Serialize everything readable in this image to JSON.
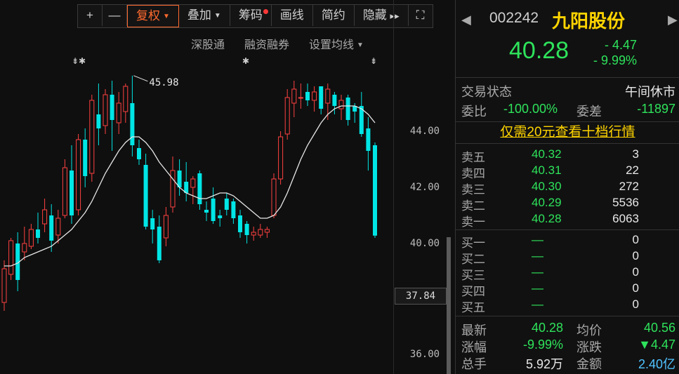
{
  "toolbar": {
    "plus": "+",
    "minus": "—",
    "fuquan": "复权",
    "diejia": "叠加",
    "chouma": "筹码",
    "huaxian": "画线",
    "jianyue": "简约",
    "yincang": "隐藏",
    "more": "▸▸",
    "expand": "⛶"
  },
  "subbar": {
    "sgt": "深股通",
    "rzrq": "融资融券",
    "ma_setting": "设置均线"
  },
  "chart": {
    "high_label": "45.98",
    "y_ticks": [
      "44.00",
      "42.00",
      "40.00",
      "36.00"
    ],
    "last_price_tag": "37.84",
    "marks": [
      "⇟✱",
      "✱",
      "⇟"
    ]
  },
  "chart_data": {
    "type": "candlestick",
    "y_axis_ticks": [
      44.0,
      42.0,
      40.0,
      36.0
    ],
    "high_marker": 45.98,
    "last_close": 40.28,
    "price_tag": 37.84,
    "candles": [
      {
        "o": 37.9,
        "h": 39.4,
        "l": 37.6,
        "c": 39.1
      },
      {
        "o": 38.9,
        "h": 40.2,
        "l": 38.7,
        "c": 40.1
      },
      {
        "o": 40.0,
        "h": 40.4,
        "l": 38.3,
        "c": 38.7
      },
      {
        "o": 39.7,
        "h": 40.6,
        "l": 39.4,
        "c": 40.0
      },
      {
        "o": 39.9,
        "h": 40.7,
        "l": 39.8,
        "c": 40.5
      },
      {
        "o": 40.5,
        "h": 41.1,
        "l": 40.0,
        "c": 40.2
      },
      {
        "o": 40.7,
        "h": 41.6,
        "l": 40.4,
        "c": 41.2
      },
      {
        "o": 41.0,
        "h": 41.4,
        "l": 39.7,
        "c": 40.1
      },
      {
        "o": 40.3,
        "h": 41.2,
        "l": 40.0,
        "c": 40.9
      },
      {
        "o": 41.0,
        "h": 43.0,
        "l": 40.9,
        "c": 42.7
      },
      {
        "o": 42.6,
        "h": 43.5,
        "l": 40.7,
        "c": 41.0
      },
      {
        "o": 41.2,
        "h": 43.9,
        "l": 41.0,
        "c": 43.7
      },
      {
        "o": 43.7,
        "h": 44.1,
        "l": 42.0,
        "c": 42.4
      },
      {
        "o": 42.5,
        "h": 45.3,
        "l": 42.2,
        "c": 45.1
      },
      {
        "o": 44.6,
        "h": 45.7,
        "l": 43.5,
        "c": 44.1
      },
      {
        "o": 44.2,
        "h": 45.5,
        "l": 43.9,
        "c": 45.3
      },
      {
        "o": 45.3,
        "h": 45.8,
        "l": 43.3,
        "c": 44.4
      },
      {
        "o": 44.3,
        "h": 45.4,
        "l": 43.9,
        "c": 45.0
      },
      {
        "o": 44.7,
        "h": 45.7,
        "l": 44.3,
        "c": 45.6
      },
      {
        "o": 45.0,
        "h": 45.98,
        "l": 43.1,
        "c": 43.5
      },
      {
        "o": 43.4,
        "h": 43.7,
        "l": 42.8,
        "c": 43.0
      },
      {
        "o": 42.8,
        "h": 43.2,
        "l": 40.5,
        "c": 40.6
      },
      {
        "o": 40.9,
        "h": 41.2,
        "l": 40.0,
        "c": 40.5
      },
      {
        "o": 40.6,
        "h": 41.0,
        "l": 39.3,
        "c": 39.4
      },
      {
        "o": 40.2,
        "h": 41.3,
        "l": 39.9,
        "c": 41.0
      },
      {
        "o": 41.3,
        "h": 43.1,
        "l": 41.1,
        "c": 42.6
      },
      {
        "o": 42.6,
        "h": 43.0,
        "l": 41.7,
        "c": 42.0
      },
      {
        "o": 42.2,
        "h": 42.9,
        "l": 41.5,
        "c": 41.8
      },
      {
        "o": 42.0,
        "h": 42.4,
        "l": 41.4,
        "c": 42.3
      },
      {
        "o": 42.5,
        "h": 42.6,
        "l": 41.2,
        "c": 41.4
      },
      {
        "o": 41.2,
        "h": 41.5,
        "l": 40.8,
        "c": 41.1
      },
      {
        "o": 41.6,
        "h": 42.0,
        "l": 40.7,
        "c": 40.8
      },
      {
        "o": 41.0,
        "h": 41.2,
        "l": 40.6,
        "c": 40.9
      },
      {
        "o": 41.6,
        "h": 41.8,
        "l": 41.0,
        "c": 41.2
      },
      {
        "o": 41.5,
        "h": 41.6,
        "l": 40.7,
        "c": 40.9
      },
      {
        "o": 41.0,
        "h": 41.2,
        "l": 40.2,
        "c": 40.4
      },
      {
        "o": 40.7,
        "h": 40.8,
        "l": 40.0,
        "c": 40.3
      },
      {
        "o": 40.3,
        "h": 40.6,
        "l": 40.1,
        "c": 40.4
      },
      {
        "o": 40.3,
        "h": 40.7,
        "l": 40.2,
        "c": 40.5
      },
      {
        "o": 40.4,
        "h": 40.6,
        "l": 40.2,
        "c": 40.5
      },
      {
        "o": 41.0,
        "h": 42.5,
        "l": 40.9,
        "c": 42.3
      },
      {
        "o": 42.3,
        "h": 44.0,
        "l": 42.1,
        "c": 43.8
      },
      {
        "o": 43.9,
        "h": 45.5,
        "l": 43.7,
        "c": 45.2
      },
      {
        "o": 45.0,
        "h": 45.8,
        "l": 44.5,
        "c": 45.5
      },
      {
        "o": 45.2,
        "h": 45.7,
        "l": 44.8,
        "c": 45.2
      },
      {
        "o": 45.4,
        "h": 45.7,
        "l": 44.9,
        "c": 45.1
      },
      {
        "o": 45.1,
        "h": 45.6,
        "l": 44.7,
        "c": 45.4
      },
      {
        "o": 45.6,
        "h": 45.6,
        "l": 44.6,
        "c": 44.8
      },
      {
        "o": 45.0,
        "h": 45.7,
        "l": 44.4,
        "c": 45.5
      },
      {
        "o": 45.3,
        "h": 45.4,
        "l": 44.6,
        "c": 44.9
      },
      {
        "o": 44.8,
        "h": 45.3,
        "l": 44.4,
        "c": 45.1
      },
      {
        "o": 45.2,
        "h": 45.3,
        "l": 44.2,
        "c": 44.4
      },
      {
        "o": 44.9,
        "h": 45.0,
        "l": 44.3,
        "c": 44.7
      },
      {
        "o": 44.9,
        "h": 45.4,
        "l": 43.8,
        "c": 43.9
      },
      {
        "o": 44.1,
        "h": 44.5,
        "l": 42.6,
        "c": 43.3
      },
      {
        "o": 43.5,
        "h": 43.6,
        "l": 40.2,
        "c": 40.28
      }
    ],
    "ma": [
      39.2,
      39.2,
      39.3,
      39.5,
      39.6,
      39.7,
      39.8,
      39.9,
      40.1,
      40.3,
      40.5,
      40.8,
      41.1,
      41.5,
      42.0,
      42.5,
      42.9,
      43.3,
      43.6,
      43.8,
      43.8,
      43.6,
      43.3,
      42.9,
      42.6,
      42.3,
      42.0,
      41.8,
      41.7,
      41.6,
      41.6,
      41.7,
      41.8,
      41.8,
      41.7,
      41.5,
      41.3,
      41.1,
      40.9,
      40.9,
      41.0,
      41.3,
      41.8,
      42.4,
      43.0,
      43.5,
      43.9,
      44.3,
      44.6,
      44.8,
      44.9,
      44.9,
      44.9,
      44.8,
      44.6,
      44.3
    ]
  },
  "stock": {
    "code": "002242",
    "name": "九阳股份",
    "price": "40.28",
    "change": "- 4.47",
    "pct": "- 9.99%"
  },
  "status": {
    "label": "交易状态",
    "value": "午间休市"
  },
  "ratio": {
    "wb_label": "委比",
    "wb": "-100.00%",
    "wc_label": "委差",
    "wc": "-11897"
  },
  "promo": "仅需20元查看十档行情",
  "asks": [
    {
      "label": "卖五",
      "price": "40.32",
      "vol": "3"
    },
    {
      "label": "卖四",
      "price": "40.31",
      "vol": "22"
    },
    {
      "label": "卖三",
      "price": "40.30",
      "vol": "272"
    },
    {
      "label": "卖二",
      "price": "40.29",
      "vol": "5536"
    },
    {
      "label": "卖一",
      "price": "40.28",
      "vol": "6063"
    }
  ],
  "bids": [
    {
      "label": "买一",
      "price": "—",
      "vol": "0"
    },
    {
      "label": "买二",
      "price": "—",
      "vol": "0"
    },
    {
      "label": "买三",
      "price": "—",
      "vol": "0"
    },
    {
      "label": "买四",
      "price": "—",
      "vol": "0"
    },
    {
      "label": "买五",
      "price": "—",
      "vol": "0"
    }
  ],
  "stats": {
    "zuixin_label": "最新",
    "zuixin": "40.28",
    "junjia_label": "均价",
    "junjia": "40.56",
    "zhangfu_label": "涨幅",
    "zhangfu": "-9.99%",
    "zhangdie_label": "涨跌",
    "zhangdie": "▼4.47",
    "zongshou_label": "总手",
    "zongshou": "5.92万",
    "jine_label": "金额",
    "jine": "2.40亿"
  },
  "colors": {
    "up": "#ff4040",
    "down": "#00e5e5",
    "ma": "#e6e6e6",
    "accent": "#ff6a2e",
    "green": "#2ee35b",
    "yellow": "#ffd400"
  }
}
